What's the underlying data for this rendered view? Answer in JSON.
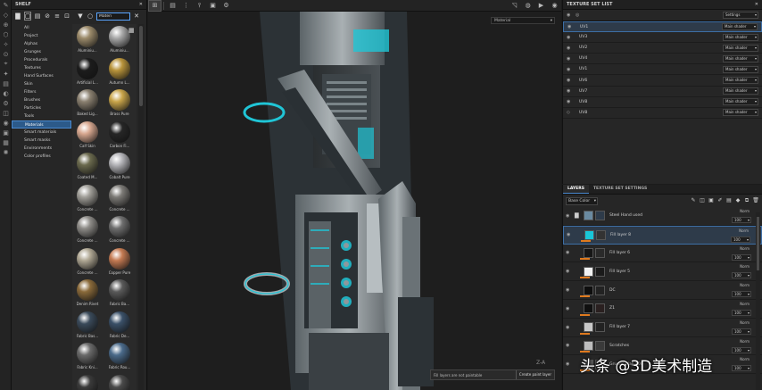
{
  "shelf": {
    "title": "SHELF",
    "search_value": "Materi",
    "categories": [
      "All",
      "Project",
      "Alphas",
      "Grunges",
      "Procedurals",
      "Textures",
      "Hand Surfaces",
      "Skin",
      "Filters",
      "Brushes",
      "Particles",
      "Tools",
      "Materials",
      "Smart materials",
      "Smart masks",
      "Environments",
      "Color profiles"
    ],
    "active_category": "Materials",
    "materials": [
      {
        "label": "Aluminiu...",
        "color": "#9b8a6a"
      },
      {
        "label": "Aluminiu...",
        "color": "#a8a8a8"
      },
      {
        "label": "Artificial L...",
        "color": "#1c1c1c"
      },
      {
        "label": "Autumn L...",
        "color": "#b8933a"
      },
      {
        "label": "Baked Lig...",
        "color": "#8a8070"
      },
      {
        "label": "Brass Pure",
        "color": "#c9a54a"
      },
      {
        "label": "Calf Skin",
        "color": "#d8a890"
      },
      {
        "label": "Carbon Fi...",
        "color": "#262626"
      },
      {
        "label": "Coated M...",
        "color": "#6b6a4e"
      },
      {
        "label": "Cobalt Pure",
        "color": "#b4b4b8"
      },
      {
        "label": "Concrete ...",
        "color": "#a09e98"
      },
      {
        "label": "Concrete ...",
        "color": "#7c7a76"
      },
      {
        "label": "Concrete ...",
        "color": "#8e8c88"
      },
      {
        "label": "Concrete ...",
        "color": "#6e6e6e"
      },
      {
        "label": "Concrete ...",
        "color": "#b0a894"
      },
      {
        "label": "Copper Pure",
        "color": "#c47a52"
      },
      {
        "label": "Denim Rivet",
        "color": "#8a6a3a"
      },
      {
        "label": "Fabric Ba...",
        "color": "#5a5a5a"
      },
      {
        "label": "Fabric Bas...",
        "color": "#3a4a5a"
      },
      {
        "label": "Fabric De...",
        "color": "#3a5068"
      },
      {
        "label": "Fabric Kni...",
        "color": "#6a6a6a"
      },
      {
        "label": "Fabric Rou...",
        "color": "#4a6a8a"
      },
      {
        "label": "",
        "color": "#3a3a3a"
      },
      {
        "label": "",
        "color": "#4a4a4a"
      }
    ]
  },
  "viewport": {
    "material_mode": "Material",
    "notice_text": "Fill layers are not paintable",
    "notice_button": "Create paint layer",
    "corner_label": "Z-A"
  },
  "texture_set_list": {
    "title": "TEXTURE SET LIST",
    "settings_label": "Settings",
    "sets": [
      {
        "name": "UV1",
        "shader": "Main shader",
        "selected": true
      },
      {
        "name": "UV3",
        "shader": "Main shader",
        "selected": false
      },
      {
        "name": "UV2",
        "shader": "Main shader",
        "selected": false
      },
      {
        "name": "UV4",
        "shader": "Main shader",
        "selected": false
      },
      {
        "name": "UV1",
        "shader": "Main shader",
        "selected": false
      },
      {
        "name": "UV6",
        "shader": "Main shader",
        "selected": false
      },
      {
        "name": "UV7",
        "shader": "Main shader",
        "selected": false
      },
      {
        "name": "UV8",
        "shader": "Main shader",
        "selected": false
      },
      {
        "name": "UV8",
        "shader": "Main shader",
        "selected": false
      }
    ]
  },
  "layers": {
    "tab_layers": "LAYERS",
    "tab_settings": "TEXTURE SET SETTINGS",
    "channel": "Base Color",
    "items": [
      {
        "name": "Steel Hand used",
        "blend": "Norm",
        "opacity": "100",
        "thumb": "#6a8aa0",
        "mask": "#2e3b4a",
        "folder": true,
        "selected": false
      },
      {
        "name": "Fill layer 8",
        "blend": "Norm",
        "opacity": "100",
        "thumb": "#19c6d8",
        "mask": "#333",
        "folder": false,
        "selected": true
      },
      {
        "name": "Fill layer 6",
        "blend": "Norm",
        "opacity": "100",
        "thumb": "#161616",
        "mask": "#2a2a2a",
        "folder": false,
        "selected": false
      },
      {
        "name": "Fill layer 5",
        "blend": "Norm",
        "opacity": "100",
        "thumb": "#f2f2f2",
        "mask": "#1a1a1a",
        "folder": false,
        "selected": false
      },
      {
        "name": "DC",
        "blend": "Norm",
        "opacity": "100",
        "thumb": "#0e0e0e",
        "mask": "#222",
        "folder": false,
        "selected": false
      },
      {
        "name": "Z1",
        "blend": "Norm",
        "opacity": "100",
        "thumb": "#101010",
        "mask": "#2a2020",
        "folder": false,
        "selected": false
      },
      {
        "name": "Fill layer 7",
        "blend": "Norm",
        "opacity": "100",
        "thumb": "#c8c8c8",
        "mask": "#222",
        "folder": false,
        "selected": false
      },
      {
        "name": "Scratches",
        "blend": "Norm",
        "opacity": "100",
        "thumb": "#bdbdbd",
        "mask": "#3a3a3a",
        "folder": false,
        "selected": false
      },
      {
        "name": "Grunge Map 008",
        "blend": "Norm",
        "opacity": "100",
        "thumb": "#555",
        "mask": "#222",
        "folder": false,
        "selected": false
      }
    ]
  },
  "watermark": "头条 @3D美术制造",
  "colors": {
    "accent": "#4a8ad0",
    "cyan": "#19c6d8",
    "orange": "#e07a1e"
  }
}
